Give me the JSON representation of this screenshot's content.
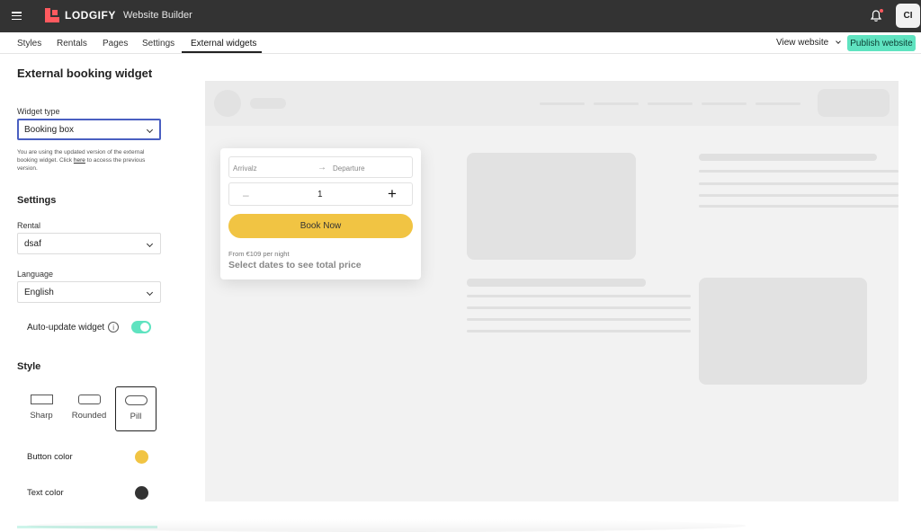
{
  "topbar": {
    "logo_text": "LODGIFY",
    "app_title": "Website Builder",
    "avatar_initials": "CI",
    "icons": [
      "menu-icon",
      "bell-icon"
    ],
    "logo_color": "#ff5a5f"
  },
  "tabs": [
    {
      "label": "Styles",
      "active": false
    },
    {
      "label": "Rentals",
      "active": false
    },
    {
      "label": "Pages",
      "active": false
    },
    {
      "label": "Settings",
      "active": false
    },
    {
      "label": "External widgets",
      "active": true
    }
  ],
  "actions": {
    "view_website": "View website",
    "publish": "Publish website",
    "publish_color": "#5fe3c0"
  },
  "panel": {
    "title": "External booking widget",
    "widget_type_label": "Widget type",
    "widget_type_value": "Booking box",
    "note_prefix": "You are using the updated version of the external booking widget. Click ",
    "note_link": "here",
    "note_suffix": " to access the previous version.",
    "settings_heading": "Settings",
    "rental_label": "Rental",
    "rental_value": "dsaf",
    "language_label": "Language",
    "language_value": "English",
    "auto_update_label": "Auto-update widget",
    "auto_update_on": true,
    "style_heading": "Style",
    "style_options": [
      {
        "label": "Sharp",
        "selected": false
      },
      {
        "label": "Rounded",
        "selected": false
      },
      {
        "label": "Pill",
        "selected": true
      }
    ],
    "button_color_label": "Button color",
    "button_color": "#f1c443",
    "text_color_label": "Text color",
    "text_color": "#333333"
  },
  "widget": {
    "arrival": "Arrivalz",
    "departure": "Departure",
    "guests": "1",
    "minus": "–",
    "plus": "+",
    "book_now": "Book Now",
    "from_price": "From €109 per night",
    "select_dates": "Select dates to see total price"
  }
}
